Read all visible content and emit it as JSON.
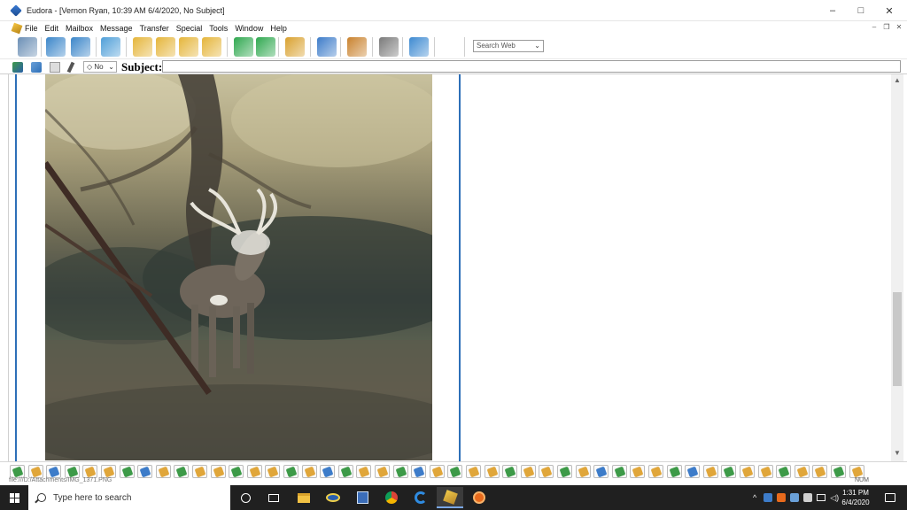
{
  "window": {
    "title": "Eudora - [Vernon Ryan, 10:39 AM 6/4/2020, No Subject]",
    "minimize": "–",
    "maximize": "□",
    "close": "✕",
    "mdi_min": "–",
    "mdi_restore": "❐",
    "mdi_close": "✕"
  },
  "menu": {
    "items": [
      "File",
      "Edit",
      "Mailbox",
      "Message",
      "Transfer",
      "Special",
      "Tools",
      "Window",
      "Help"
    ]
  },
  "toolbar": {
    "search_placeholder": "Search Web",
    "buttons": [
      {
        "icon": "trash-can-icon",
        "color": "#6b8fb5"
      },
      {
        "icon": "check-mail-icon",
        "color": "#3b86c9"
      },
      {
        "icon": "send-queued-icon",
        "color": "#3b86c9"
      },
      {
        "icon": "new-message-icon",
        "color": "#4f9fd8"
      },
      {
        "icon": "reply-icon",
        "color": "#e5b53a"
      },
      {
        "icon": "reply-all-icon",
        "color": "#e5b53a"
      },
      {
        "icon": "forward-icon",
        "color": "#e5b53a"
      },
      {
        "icon": "redirect-icon",
        "color": "#e5b53a"
      },
      {
        "icon": "previous-message-icon",
        "color": "#2fa84f"
      },
      {
        "icon": "next-message-icon",
        "color": "#2fa84f"
      },
      {
        "icon": "attach-file-icon",
        "color": "#d9a12e"
      },
      {
        "icon": "find-icon",
        "color": "#3d7cc9"
      },
      {
        "icon": "address-book-icon",
        "color": "#c9822d"
      },
      {
        "icon": "print-icon",
        "color": "#7a7a7a"
      },
      {
        "icon": "help-icon",
        "color": "#3d8ad1"
      }
    ]
  },
  "subject_bar": {
    "priority_value": "No",
    "subject_label": "Subject:",
    "subject_value": ""
  },
  "mailboxes": {
    "count": 47
  },
  "status": {
    "path": "file:///D:/Attachments/IMG_1371.PNG",
    "num": "NUM"
  },
  "taskbar": {
    "search_placeholder": "Type here to search",
    "time": "1:31 PM",
    "date": "6/4/2020",
    "tray_expand": "^"
  }
}
